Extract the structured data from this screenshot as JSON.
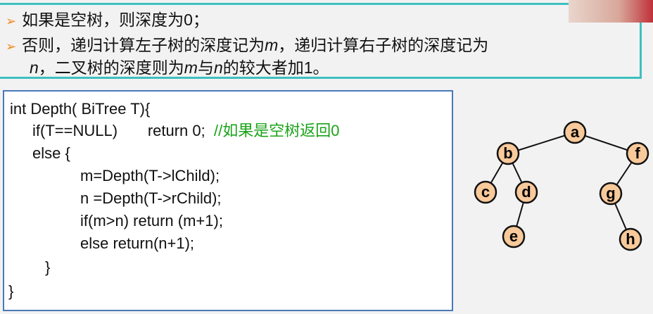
{
  "bullets": [
    {
      "text": "如果是空树，则深度为0；"
    },
    {
      "parts": [
        "否则，递归计算左子树的深度记为",
        "m",
        "，递归计算右子树的深度记为"
      ]
    },
    {
      "parts": [
        "n",
        "，二叉树的深度则为",
        "m",
        "与",
        "n",
        "的较大者加1。"
      ]
    }
  ],
  "code": {
    "lines": [
      "int Depth( BiTree T){",
      "if(T==NULL)       return 0;",
      "else {",
      "m=Depth(T->lChild);",
      "n =Depth(T->rChild);",
      "if(m>n) return (m+1);",
      "else return(n+1);",
      "}",
      "}"
    ],
    "comment": "//如果是空树返回0"
  },
  "tree": {
    "fill": "#f8c99a",
    "nodes": [
      {
        "label": "a"
      },
      {
        "label": "b"
      },
      {
        "label": "f"
      },
      {
        "label": "c"
      },
      {
        "label": "d"
      },
      {
        "label": "g"
      },
      {
        "label": "e"
      },
      {
        "label": "h"
      }
    ],
    "edges": [
      [
        "a",
        "b"
      ],
      [
        "a",
        "f"
      ],
      [
        "b",
        "c"
      ],
      [
        "b",
        "d"
      ],
      [
        "d",
        "e"
      ],
      [
        "f",
        "g"
      ],
      [
        "g",
        "h"
      ]
    ]
  }
}
